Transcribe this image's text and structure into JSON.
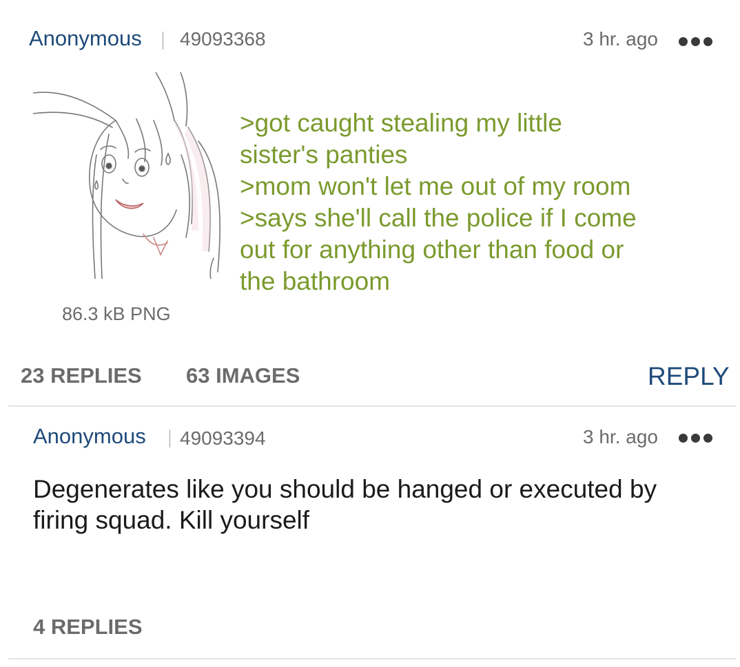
{
  "thread": {
    "op": {
      "name": "Anonymous",
      "post_id": "49093368",
      "time": "3 hr. ago",
      "file_info": "86.3 kB PNG",
      "greentext_lines": [
        ">got caught stealing my little",
        "sister's panties",
        ">mom won't let me out of my room",
        ">says she'll call the police if I come",
        "out for anything other than food or",
        "the bathroom"
      ],
      "replies_label": "23 REPLIES",
      "images_label": "63 IMAGES",
      "reply_label": "REPLY",
      "more_icon": "more-horizontal-icon"
    },
    "reply_post": {
      "name": "Anonymous",
      "post_id": "49093394",
      "time": "3 hr. ago",
      "body_lines": [
        "Degenerates like you should be hanged or executed by",
        "firing squad. Kill yourself"
      ],
      "replies_label": "4 REPLIES",
      "more_icon": "more-horizontal-icon"
    }
  },
  "colors": {
    "name_blue": "#1e4a7a",
    "greentext": "#7b9a2e",
    "meta_gray": "#6b6b6b",
    "body_text": "#1a1a1a",
    "divider": "#e4e4e4"
  }
}
